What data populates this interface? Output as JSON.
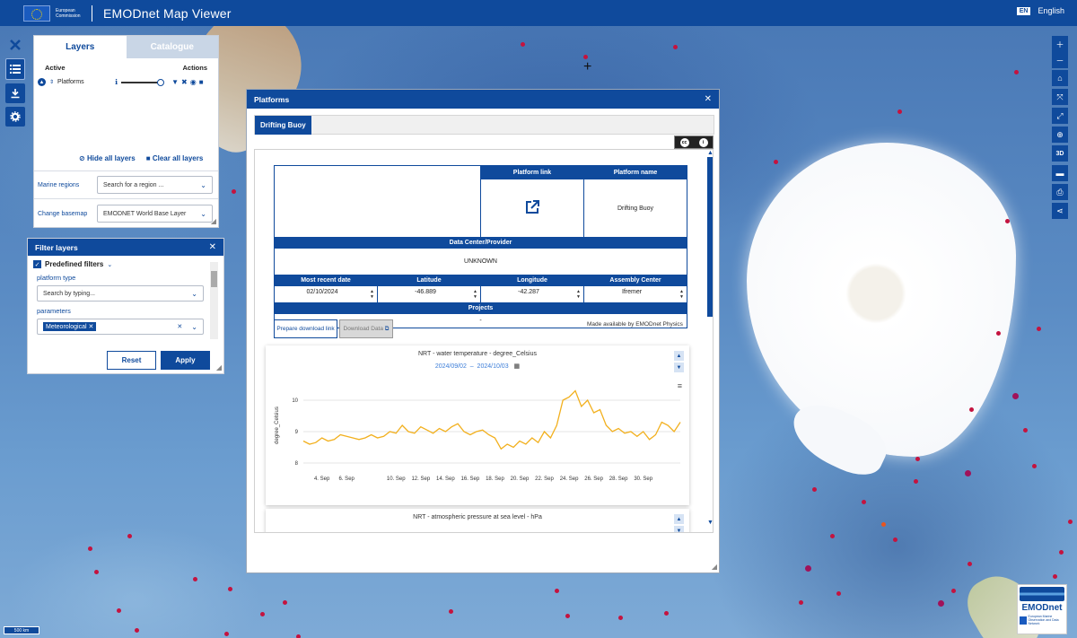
{
  "header": {
    "ec_text": "European Commission",
    "title": "EMODnet Map Viewer",
    "lang_code": "EN",
    "lang_label": "English"
  },
  "layers_panel": {
    "tabs": [
      "Layers",
      "Catalogue"
    ],
    "col_active": "Active",
    "col_actions": "Actions",
    "layer_name": "Platforms",
    "hide_all": "Hide all layers",
    "clear_all": "Clear all layers",
    "marine_regions_label": "Marine regions",
    "marine_regions_placeholder": "Search for a region ...",
    "basemap_label": "Change basemap",
    "basemap_value": "EMODNET World Base Layer"
  },
  "filter_panel": {
    "title": "Filter layers",
    "predefined": "Predefined filters",
    "platform_type_label": "platform type",
    "platform_type_placeholder": "Search by typing...",
    "parameters_label": "parameters",
    "parameter_chip": "Meteorological",
    "reset": "Reset",
    "apply": "Apply"
  },
  "platforms_dialog": {
    "title": "Platforms",
    "tab": "Drifting Buoy",
    "col_platform_link": "Platform link",
    "col_platform_name": "Platform name",
    "platform_name": "Drifting Buoy",
    "col_data_center": "Data Center/Provider",
    "data_center": "UNKNOWN",
    "col_recent_date": "Most recent date",
    "col_latitude": "Latitude",
    "col_longitude": "Longitude",
    "col_assembly": "Assembly Center",
    "recent_date": "02/10/2024",
    "latitude": "-46.889",
    "longitude": "-42.287",
    "assembly": "Ifremer",
    "col_projects": "Projects",
    "projects": "-",
    "made_by": "Made available by EMODnet Physics",
    "prepare_download": "Prepare download link",
    "download_data": "Download Data"
  },
  "chart_data": [
    {
      "type": "line",
      "title": "NRT - water temperature - degree_Celsius",
      "date_from": "2024/09/02",
      "date_to": "2024/10/03",
      "range_sep": "–",
      "ylabel": "degree_Celsius",
      "ylim": [
        7.8,
        10.6
      ],
      "yticks": [
        8,
        9,
        10
      ],
      "xticks": [
        "4. Sep",
        "6. Sep",
        "10. Sep",
        "12. Sep",
        "14. Sep",
        "16. Sep",
        "18. Sep",
        "20. Sep",
        "22. Sep",
        "24. Sep",
        "26. Sep",
        "28. Sep",
        "30. Sep"
      ],
      "xtick_days": [
        4,
        6,
        10,
        12,
        14,
        16,
        18,
        20,
        22,
        24,
        26,
        28,
        30
      ],
      "xlim_days": [
        2.5,
        33
      ],
      "color": "#f2b01e",
      "series": [
        {
          "x": [
            2.5,
            3,
            3.5,
            4,
            4.5,
            5,
            5.5,
            6,
            6.5,
            7,
            7.5,
            8,
            8.5,
            9,
            9.5,
            10,
            10.5,
            11,
            11.5,
            12,
            12.5,
            13,
            13.5,
            14,
            14.5,
            15,
            15.5,
            16,
            16.5,
            17,
            17.5,
            18,
            18.5,
            19,
            19.5,
            20,
            20.5,
            21,
            21.5,
            22,
            22.5,
            23,
            23.5,
            24,
            24.5,
            25,
            25.5,
            26,
            26.5,
            27,
            27.5,
            28,
            28.5,
            29,
            29.5,
            30,
            30.5,
            31,
            31.5,
            32,
            32.5,
            33
          ],
          "values": [
            8.7,
            8.6,
            8.65,
            8.8,
            8.7,
            8.75,
            8.9,
            8.85,
            8.8,
            8.75,
            8.8,
            8.9,
            8.8,
            8.85,
            9.0,
            8.95,
            9.2,
            9.0,
            8.95,
            9.15,
            9.05,
            8.95,
            9.1,
            9.0,
            9.15,
            9.25,
            9.0,
            8.9,
            9.0,
            9.05,
            8.9,
            8.8,
            8.45,
            8.6,
            8.5,
            8.7,
            8.6,
            8.8,
            8.65,
            9.0,
            8.8,
            9.2,
            10.0,
            10.1,
            10.3,
            9.8,
            10.0,
            9.6,
            9.7,
            9.2,
            9.0,
            9.1,
            8.95,
            9.0,
            8.85,
            9.0,
            8.75,
            8.9,
            9.3,
            9.2,
            9.0,
            9.3
          ]
        }
      ]
    },
    {
      "type": "line",
      "title": "NRT - atmospheric pressure at sea level - hPa"
    }
  ]
}
